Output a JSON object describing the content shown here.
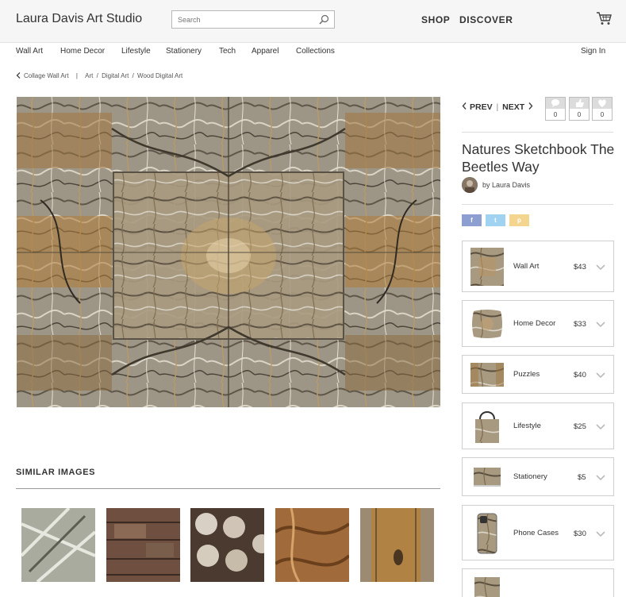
{
  "header": {
    "brand": "Laura Davis Art Studio",
    "search_placeholder": "Search",
    "nav_shop": "SHOP",
    "nav_discover": "DISCOVER"
  },
  "categories": [
    "Wall Art",
    "Home Decor",
    "Lifestyle",
    "Stationery",
    "Tech",
    "Apparel",
    "Collections"
  ],
  "sign_in": "Sign In",
  "breadcrumb": {
    "back": "Collage Wall Art",
    "divider": "|",
    "art": "Art",
    "digital_art": "Digital Art",
    "wood_digital_art": "Wood Digital Art",
    "slash": "/"
  },
  "artwork": {
    "title": "Natures Sketchbook The Beetles Way",
    "artist": "by Laura Davis"
  },
  "pager": {
    "prev": "PREV",
    "divider": "|",
    "next": "NEXT"
  },
  "counters": {
    "comments": "0",
    "likes": "0",
    "favorites": "0"
  },
  "share": {
    "facebook": "f",
    "twitter": "t",
    "pinterest": "p"
  },
  "similar_heading": "SIMILAR  IMAGES",
  "products": [
    {
      "name": "Wall Art",
      "price": "$43"
    },
    {
      "name": "Home Decor",
      "price": "$33"
    },
    {
      "name": "Puzzles",
      "price": "$40"
    },
    {
      "name": "Lifestyle",
      "price": "$25"
    },
    {
      "name": "Stationery",
      "price": "$5"
    },
    {
      "name": "Phone Cases",
      "price": "$30"
    }
  ],
  "colors": {
    "facebook": "#8d9fd1",
    "twitter": "#9fd3f1",
    "pinterest": "#f4d58f",
    "counter_top": "#dcdcdc"
  }
}
